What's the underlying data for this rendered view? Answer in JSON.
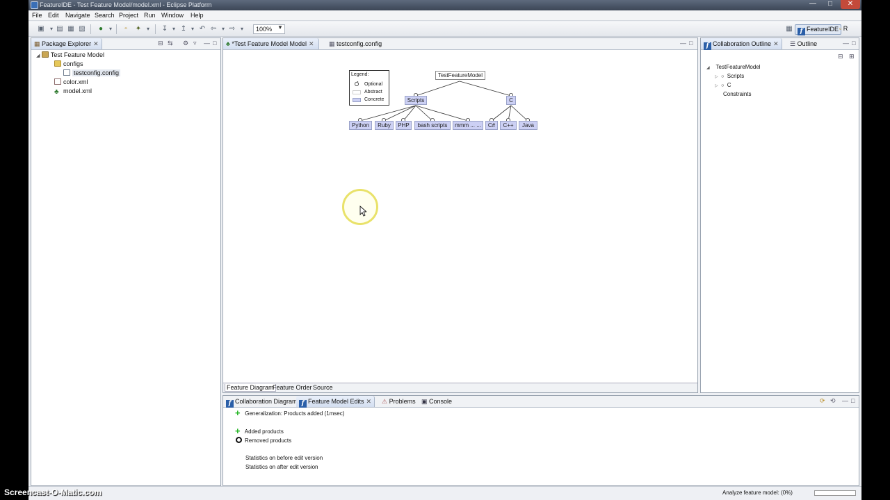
{
  "window": {
    "title": "FeatureIDE - Test Feature Model/model.xml - Eclipse Platform"
  },
  "menu": [
    "File",
    "Edit",
    "Navigate",
    "Search",
    "Project",
    "Run",
    "Window",
    "Help"
  ],
  "toolbar": {
    "zoom": "100%",
    "perspectives": [
      "FeatureIDE",
      "R"
    ]
  },
  "package_explorer": {
    "tab": "Package Explorer",
    "items": [
      "Test Feature Model",
      "configs",
      "testconfig.config",
      "color.xml",
      "model.xml"
    ]
  },
  "editor": {
    "tabs": [
      "*Test Feature Model Model",
      "testconfig.config"
    ],
    "bottom_tabs": [
      "Feature Diagram",
      "Feature Order",
      "Source"
    ],
    "legend": {
      "title": "Legend:",
      "items": [
        "Optional",
        "Abstract",
        "Concrete"
      ]
    },
    "diagram": {
      "root": "TestFeatureModel",
      "level1": [
        "Scripts",
        "C"
      ],
      "scripts_children": [
        "Python",
        "Ruby",
        "PHP",
        "bash scripts",
        "mmm ... ..."
      ],
      "c_children": [
        "C#",
        "C++",
        "Java"
      ]
    }
  },
  "outline": {
    "tabs": [
      "Collaboration Outline",
      "Outline"
    ],
    "root": "TestFeatureModel",
    "children": [
      "Scripts",
      "C"
    ],
    "constraints": "Constraints"
  },
  "bottom_panel": {
    "tabs": [
      "Collaboration Diagram",
      "Feature Model Edits",
      "Problems",
      "Console"
    ],
    "generalization": "Generalization: Products added (1msec)",
    "added": "Added products",
    "removed": "Removed products",
    "stats_before": "Statistics on before edit version",
    "stats_after": "Statistics on after edit version"
  },
  "status": {
    "text": "Analyze feature model: (0%)",
    "progress": 0
  },
  "watermark": "Screencast-O-Matic.com",
  "colors": {
    "concrete": "#ccd0f4",
    "accent": "#2b5fa8",
    "add_green": "#1fb41f"
  }
}
